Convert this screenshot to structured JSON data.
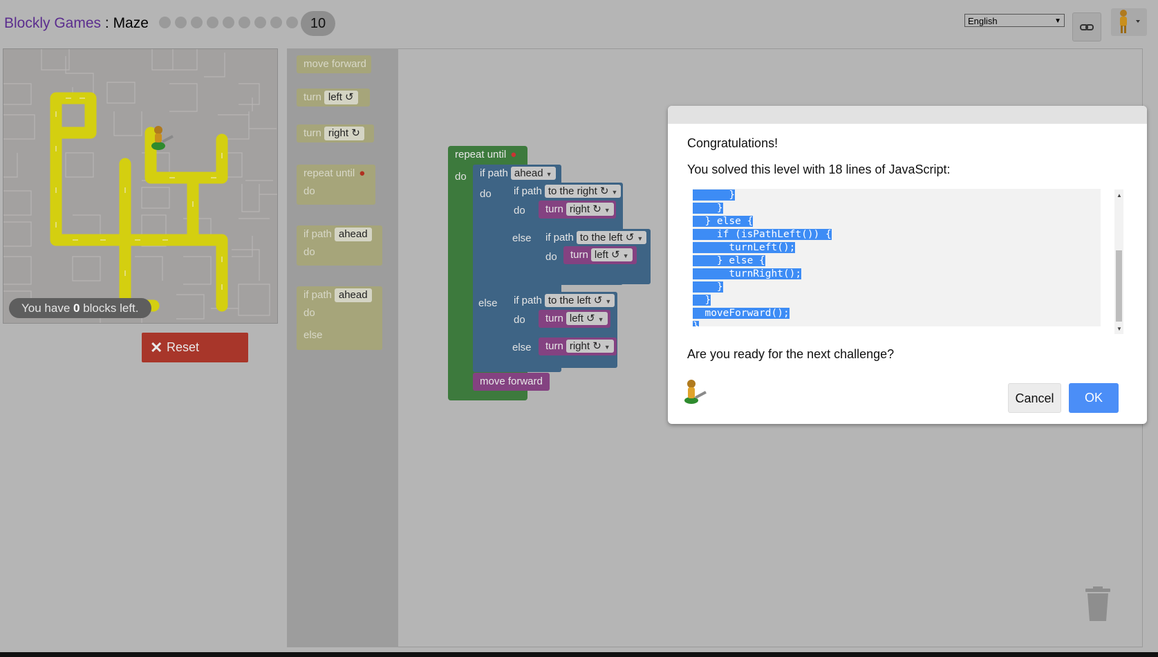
{
  "header": {
    "app_name": "Blockly Games",
    "separator": " : ",
    "game_name": "Maze",
    "level_dots": 9,
    "current_level": "10",
    "language": "English"
  },
  "maze": {
    "blocks_left_prefix": "You have ",
    "blocks_left_count": "0",
    "blocks_left_suffix": " blocks left.",
    "reset_label": "Reset"
  },
  "toolbox": {
    "move_forward": "move forward",
    "turn": "turn",
    "left": "left ↺",
    "right": "right ↻",
    "repeat_until": "repeat until",
    "do": "do",
    "else": "else",
    "if_path": "if path",
    "ahead": "ahead"
  },
  "program": {
    "repeat_until": "repeat until",
    "do": "do",
    "else": "else",
    "if_path": "if path",
    "ahead": "ahead",
    "to_the_right": "to the right ↻",
    "to_the_left": "to the left ↺",
    "turn": "turn",
    "right": "right ↻",
    "left": "left ↺",
    "move_forward": "move forward"
  },
  "dialog": {
    "congrats": "Congratulations!",
    "solved": "You solved this level with 18 lines of JavaScript:",
    "code_lines": [
      "      }",
      "    }",
      "  } else {",
      "    if (isPathLeft()) {",
      "      turnLeft();",
      "    } else {",
      "      turnRight();",
      "    }",
      "  }",
      "  moveForward();",
      "}"
    ],
    "next": "Are you ready for the next challenge?",
    "cancel_label": "Cancel",
    "ok_label": "OK"
  },
  "colors": {
    "background": "#b5b5b5",
    "reset": "#a8362a",
    "ok": "#4b8ef7",
    "loop_block": "#3d7a3d",
    "logic_block": "#3e6485",
    "movement_block": "#844281",
    "maze_path": "#d4cf10"
  }
}
